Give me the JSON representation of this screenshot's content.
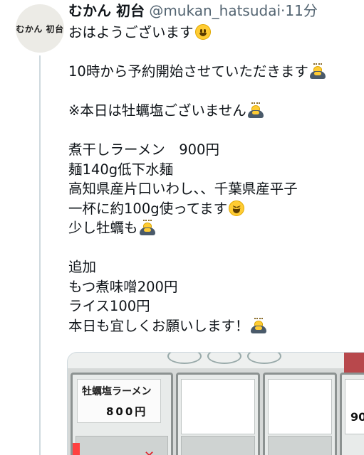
{
  "avatar": {
    "label": "むかん 初台"
  },
  "header": {
    "name": "むかん 初台",
    "handle": "@mukan_hatsudai",
    "separator": "·",
    "time": "11分"
  },
  "tweet": {
    "lines": {
      "l1": "おはようございます",
      "l2": "10時から予約開始させていただきます",
      "l3": "※本日は牡蠣塩ございません",
      "l4": "煮干しラーメン　900円",
      "l5": "麺140g低下水麺",
      "l6": "高知県産片口いわし、、千葉県産平子",
      "l7": "一杯に約100g使ってます",
      "l8": "少し牡蠣も",
      "l9": "追加",
      "l10": "もつ煮味噌200円",
      "l11": "ライス100円",
      "l12": "本日も宜しくお願いします！"
    },
    "emojis": {
      "smile": "grinning-face-emoji",
      "bow": "person-bowing-emoji",
      "laugh": "laughing-face-emoji"
    }
  },
  "media": {
    "card_title": "牡蠣塩ラーメン",
    "card_price": "800円",
    "x_mark": "✕",
    "right_price": "90"
  }
}
